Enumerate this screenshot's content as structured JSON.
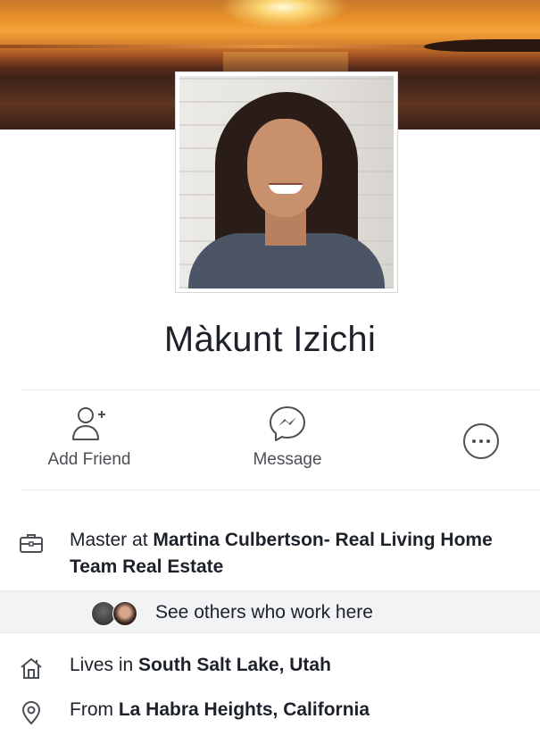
{
  "profile": {
    "name": "Màkunt Izichi"
  },
  "actions": {
    "add_friend": "Add Friend",
    "message": "Message"
  },
  "intro": {
    "work_prefix": "Master at ",
    "work_place": "Martina Culbertson- Real Living Home Team Real Estate",
    "coworkers_label": "See others who work here",
    "lives_prefix": "Lives in ",
    "lives_place": "South Salt Lake, Utah",
    "from_prefix": "From ",
    "from_place": "La Habra Heights, California"
  },
  "icons": {
    "add_friend": "add-friend-icon",
    "message": "messenger-icon",
    "more": "more-icon",
    "work": "briefcase-icon",
    "home": "home-icon",
    "from": "location-pin-icon"
  },
  "colors": {
    "text": "#1d2129",
    "secondary_text": "#4b4f56",
    "icon": "#4b4f56",
    "highlight_bg": "#f2f3f5"
  }
}
